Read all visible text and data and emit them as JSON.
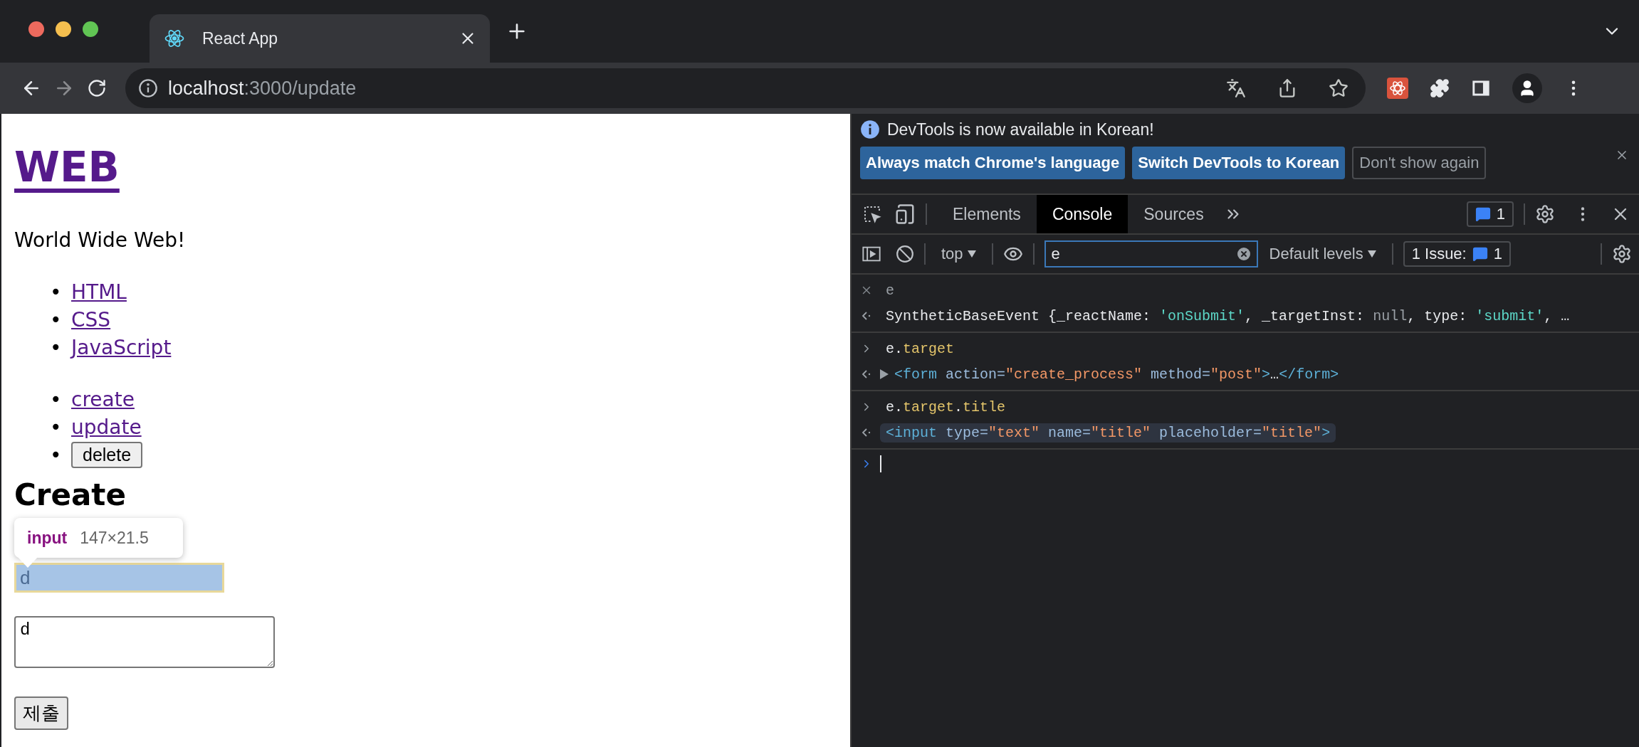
{
  "browser": {
    "tabs": [
      {
        "title": "React App",
        "selected": true
      }
    ],
    "nav": [
      {
        "kind": "back",
        "disabled": false
      },
      {
        "kind": "forward",
        "disabled": true
      },
      {
        "kind": "reload",
        "disabled": false
      }
    ],
    "url": {
      "host": "localhost",
      "path": ":3000/update"
    }
  },
  "page": {
    "title": "WEB",
    "subtitle": "World Wide Web!",
    "topics": [
      {
        "bullet": "•",
        "label": "HTML"
      },
      {
        "bullet": "•",
        "label": "CSS"
      },
      {
        "bullet": "•",
        "label": "JavaScript"
      }
    ],
    "controls": [
      {
        "bullet": "•",
        "kind": "link",
        "label": "create"
      },
      {
        "bullet": "•",
        "kind": "link",
        "label": "update"
      },
      {
        "bullet": "•",
        "kind": "button",
        "label": "delete"
      }
    ],
    "heading": "Create",
    "inspect_tooltip": {
      "tag": "input",
      "size": "147×21.5"
    },
    "title_input": {
      "value": "d",
      "highlighted": true
    },
    "body_textarea": {
      "value": "d"
    },
    "submit": "제출"
  },
  "devtools": {
    "infobar": {
      "message": "DevTools is now available in Korean!",
      "buttons": [
        {
          "label": "Always match Chrome's language",
          "kind": "primary"
        },
        {
          "label": "Switch DevTools to Korean",
          "kind": "primary"
        },
        {
          "label": "Don't show again",
          "kind": "plain"
        }
      ]
    },
    "tabs": [
      {
        "label": "Elements",
        "selected": false
      },
      {
        "label": "Console",
        "selected": true
      },
      {
        "label": "Sources",
        "selected": false
      }
    ],
    "message_count": "1",
    "console_toolbar": {
      "context": "top",
      "filter": "e",
      "levels": "Default levels",
      "issues_label": "1 Issue:",
      "issues_count": "1"
    },
    "console": [
      {
        "stale": true,
        "input": [
          {
            "text": "e",
            "kind": "plain"
          }
        ],
        "expandable": false,
        "hovered": false,
        "output": [
          {
            "text": "SyntheticBaseEvent {_reactName: ",
            "kind": "plain"
          },
          {
            "text": "'onSubmit'",
            "kind": "string"
          },
          {
            "text": ", _targetInst: ",
            "kind": "plain"
          },
          {
            "text": "null",
            "kind": "null"
          },
          {
            "text": ", type: ",
            "kind": "plain"
          },
          {
            "text": "'submit'",
            "kind": "string"
          },
          {
            "text": ", …",
            "kind": "plain"
          }
        ]
      },
      {
        "stale": false,
        "input": [
          {
            "text": "e.",
            "kind": "plain"
          },
          {
            "text": "target",
            "kind": "prop"
          }
        ],
        "expandable": true,
        "hovered": false,
        "output": [
          {
            "text": "<form ",
            "kind": "tag"
          },
          {
            "text": "action=",
            "kind": "attr"
          },
          {
            "text": "\"create_process\"",
            "kind": "value"
          },
          {
            "text": " method=",
            "kind": "attr"
          },
          {
            "text": "\"post\"",
            "kind": "value"
          },
          {
            "text": ">",
            "kind": "tag"
          },
          {
            "text": "…",
            "kind": "plain"
          },
          {
            "text": "</form>",
            "kind": "tag"
          }
        ]
      },
      {
        "stale": false,
        "input": [
          {
            "text": "e.",
            "kind": "plain"
          },
          {
            "text": "target",
            "kind": "prop"
          },
          {
            "text": ".",
            "kind": "plain"
          },
          {
            "text": "title",
            "kind": "prop"
          }
        ],
        "expandable": false,
        "hovered": true,
        "output": [
          {
            "text": "<input ",
            "kind": "tag"
          },
          {
            "text": "type=",
            "kind": "attr"
          },
          {
            "text": "\"text\"",
            "kind": "value"
          },
          {
            "text": " name=",
            "kind": "attr"
          },
          {
            "text": "\"title\"",
            "kind": "value"
          },
          {
            "text": " placeholder=",
            "kind": "attr"
          },
          {
            "text": "\"title\"",
            "kind": "value"
          },
          {
            "text": ">",
            "kind": "tag"
          }
        ]
      }
    ]
  }
}
